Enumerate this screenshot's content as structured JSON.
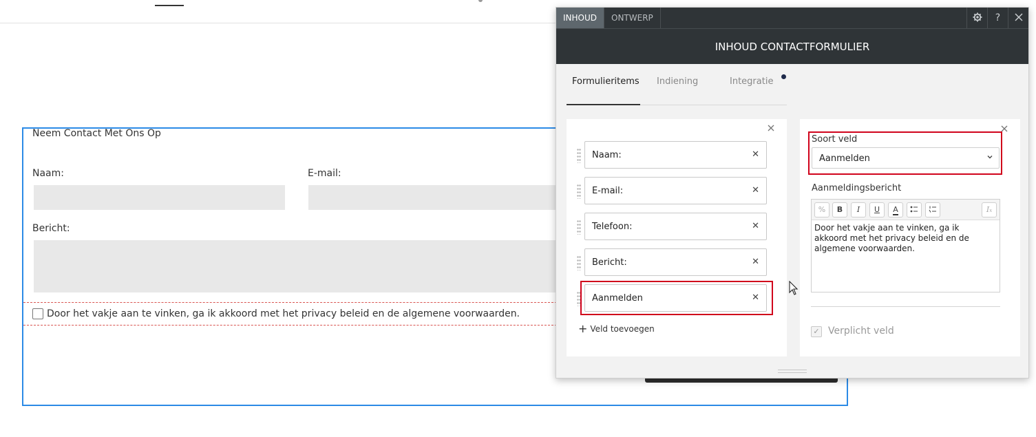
{
  "panel": {
    "tabs": [
      {
        "label": "INHOUD",
        "active": true
      },
      {
        "label": "ONTWERP",
        "active": false
      }
    ],
    "title": "INHOUD CONTACTFORMULIER",
    "icons": [
      "gear-icon",
      "help-icon",
      "close-icon"
    ],
    "help_glyph": "?",
    "sub_tabs": [
      {
        "label": "Formulieritems",
        "active": true
      },
      {
        "label": "Indiening",
        "active": false
      },
      {
        "label": "Integratie",
        "active": false
      }
    ],
    "form_items": [
      {
        "label": "Naam:"
      },
      {
        "label": "E-mail:"
      },
      {
        "label": "Telefoon:"
      },
      {
        "label": "Bericht:"
      },
      {
        "label": "Aanmelden",
        "selected": true
      }
    ],
    "add_field_label": "Veld toevoegen",
    "field_settings": {
      "type_label": "Soort veld",
      "type_value": "Aanmelden",
      "message_label": "Aanmeldingsbericht",
      "message_text": "Door het vakje aan te vinken, ga ik akkoord met het privacy beleid en de algemene voorwaarden.",
      "required_label": "Verplicht veld",
      "required_checked": true,
      "toolbar_buttons": [
        "link-icon",
        "bold-icon",
        "italic-icon",
        "underline-icon",
        "text-color-icon",
        "bullet-list-icon",
        "numbered-list-icon",
        "clear-format-icon"
      ]
    }
  },
  "form": {
    "title": "Neem Contact Met Ons Op",
    "fields": [
      {
        "label": "Naam:"
      },
      {
        "label": "E-mail:"
      },
      {
        "label": "Bericht:"
      }
    ],
    "consent_text": "Door het vakje aan te vinken, ga ik akkoord met het privacy beleid en de algemene voorwaarden."
  },
  "colors": {
    "accent_blue": "#2b8ae6",
    "highlight_red": "#d0021b",
    "panel_dark": "#2f3437"
  }
}
